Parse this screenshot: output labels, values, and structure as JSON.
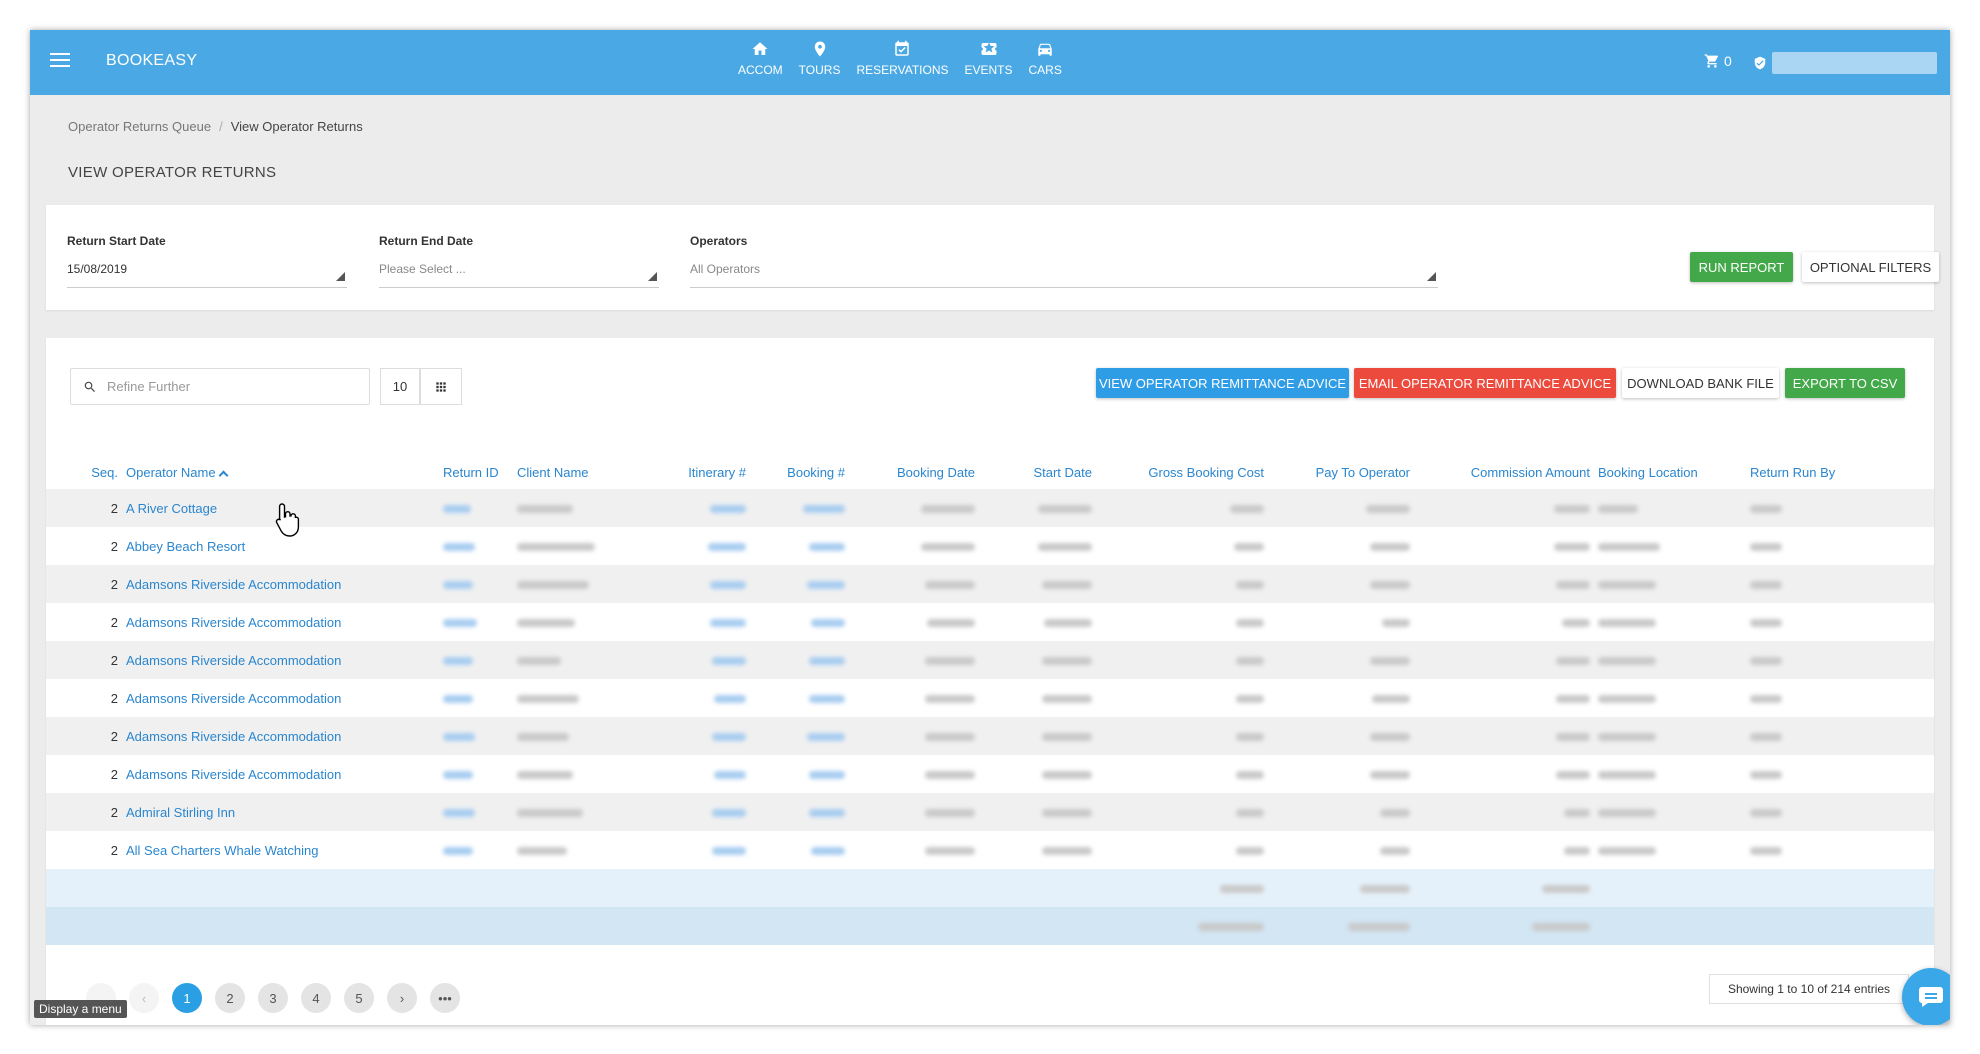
{
  "header": {
    "brand": "BOOKEASY",
    "nav": [
      {
        "label": "ACCOM",
        "icon": "home-icon"
      },
      {
        "label": "TOURS",
        "icon": "location-pin-icon"
      },
      {
        "label": "RESERVATIONS",
        "icon": "calendar-check-icon"
      },
      {
        "label": "EVENTS",
        "icon": "ticket-icon"
      },
      {
        "label": "CARS",
        "icon": "car-icon"
      }
    ],
    "cart_count": "0"
  },
  "breadcrumb": {
    "parent": "Operator Returns Queue",
    "current": "View Operator Returns"
  },
  "page_title": "VIEW OPERATOR RETURNS",
  "filters": {
    "start_label": "Return Start Date",
    "start_value": "15/08/2019",
    "end_label": "Return End Date",
    "end_placeholder": "Please Select ...",
    "operators_label": "Operators",
    "operators_value": "All Operators",
    "run_report": "RUN REPORT",
    "optional_filters": "OPTIONAL FILTERS"
  },
  "toolbar": {
    "search_placeholder": "Refine Further",
    "page_size": "10",
    "view_remittance": "VIEW OPERATOR REMITTANCE ADVICE",
    "email_remittance": "EMAIL OPERATOR REMITTANCE ADVICE",
    "download_bank": "DOWNLOAD BANK FILE",
    "export_csv": "EXPORT TO CSV"
  },
  "table": {
    "columns": [
      "Seq.",
      "Operator Name",
      "Return ID",
      "Client Name",
      "Itinerary #",
      "Booking #",
      "Booking Date",
      "Start Date",
      "Gross Booking Cost",
      "Pay To Operator",
      "Commission Amount",
      "Booking Location",
      "Return Run By"
    ],
    "rows": [
      {
        "seq": "2",
        "operator": "A River Cottage"
      },
      {
        "seq": "2",
        "operator": "Abbey Beach Resort"
      },
      {
        "seq": "2",
        "operator": "Adamsons Riverside Accommodation"
      },
      {
        "seq": "2",
        "operator": "Adamsons Riverside Accommodation"
      },
      {
        "seq": "2",
        "operator": "Adamsons Riverside Accommodation"
      },
      {
        "seq": "2",
        "operator": "Adamsons Riverside Accommodation"
      },
      {
        "seq": "2",
        "operator": "Adamsons Riverside Accommodation"
      },
      {
        "seq": "2",
        "operator": "Adamsons Riverside Accommodation"
      },
      {
        "seq": "2",
        "operator": "Admiral Stirling Inn"
      },
      {
        "seq": "2",
        "operator": "All Sea Charters Whale Watching"
      }
    ]
  },
  "pagination": {
    "pages": [
      "1",
      "2",
      "3",
      "4",
      "5"
    ],
    "showing": "Showing 1 to 10 of 214 entries"
  },
  "tooltip": "Display a menu",
  "colors": {
    "primary": "#4aa9e4",
    "success": "#43a84a",
    "danger": "#ec4a3c",
    "info": "#2f9de6",
    "link": "#2a86cf"
  }
}
